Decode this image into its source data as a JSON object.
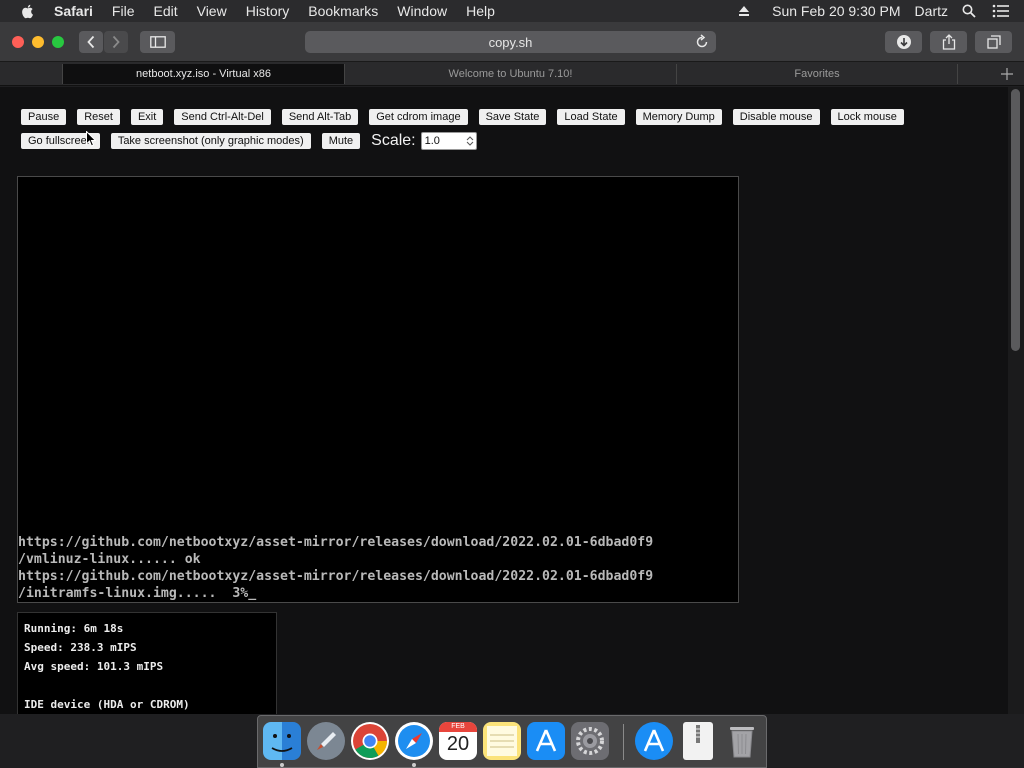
{
  "menubar": {
    "app": "Safari",
    "items": [
      "File",
      "Edit",
      "View",
      "History",
      "Bookmarks",
      "Window",
      "Help"
    ],
    "datetime": "Sun Feb 20  9:30 PM",
    "user": "Dartz"
  },
  "toolbar": {
    "address": "copy.sh"
  },
  "tabs": [
    {
      "label": "netboot.xyz.iso - Virtual x86",
      "active": true
    },
    {
      "label": "Welcome to Ubuntu 7.10!",
      "active": false
    },
    {
      "label": "Favorites",
      "active": false
    }
  ],
  "controls": {
    "row1": [
      "Pause",
      "Reset",
      "Exit",
      "Send Ctrl-Alt-Del",
      "Send Alt-Tab",
      "Get cdrom image",
      "Save State",
      "Load State",
      "Memory Dump",
      "Disable mouse",
      "Lock mouse"
    ],
    "row2": [
      "Go fullscreen",
      "Take screenshot (only graphic modes)",
      "Mute"
    ],
    "scale_label": "Scale:",
    "scale_value": "1.0"
  },
  "terminal": {
    "lines": [
      "https://github.com/netbootxyz/asset-mirror/releases/download/2022.02.01-6dbad0f9",
      "/vmlinuz-linux...... ok",
      "https://github.com/netbootxyz/asset-mirror/releases/download/2022.02.01-6dbad0f9",
      "/initramfs-linux.img.....  3%_"
    ]
  },
  "status": {
    "running": "Running: 6m 18s",
    "speed": "Speed: 238.3 mIPS",
    "avg_speed": "Avg speed: 101.3 mIPS",
    "ide": "IDE device (HDA or CDROM)"
  },
  "dock": {
    "calendar_month": "FEB",
    "calendar_day": "20",
    "items": [
      "finder-icon",
      "launchpad-icon",
      "chrome-icon",
      "safari-icon",
      "calendar-icon",
      "notes-icon",
      "app-store-icon",
      "system-preferences-icon",
      "app-store-download-icon",
      "document-icon",
      "trash-icon"
    ]
  },
  "colors": {
    "traffic_red": "#fe5f57",
    "traffic_yellow": "#febc2e",
    "traffic_green": "#28c840"
  }
}
